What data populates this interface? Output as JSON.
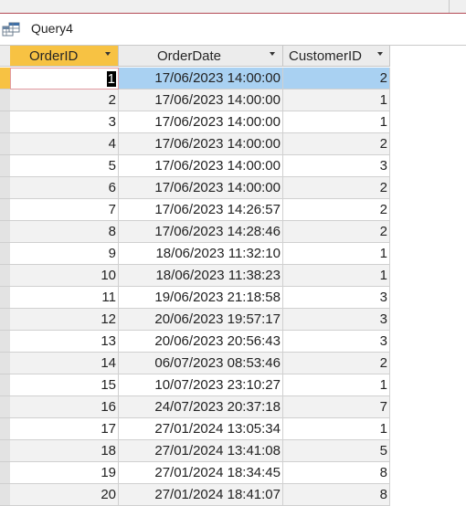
{
  "tab": {
    "title": "Query4",
    "icon": "query-datasheet-icon"
  },
  "columns": [
    {
      "label": "OrderID",
      "active": true
    },
    {
      "label": "OrderDate",
      "active": false
    },
    {
      "label": "CustomerID",
      "active": false
    }
  ],
  "rows": [
    {
      "order_id": "1",
      "order_date": "17/06/2023 14:00:00",
      "customer_id": "2"
    },
    {
      "order_id": "2",
      "order_date": "17/06/2023 14:00:00",
      "customer_id": "1"
    },
    {
      "order_id": "3",
      "order_date": "17/06/2023 14:00:00",
      "customer_id": "1"
    },
    {
      "order_id": "4",
      "order_date": "17/06/2023 14:00:00",
      "customer_id": "2"
    },
    {
      "order_id": "5",
      "order_date": "17/06/2023 14:00:00",
      "customer_id": "3"
    },
    {
      "order_id": "6",
      "order_date": "17/06/2023 14:00:00",
      "customer_id": "2"
    },
    {
      "order_id": "7",
      "order_date": "17/06/2023 14:26:57",
      "customer_id": "2"
    },
    {
      "order_id": "8",
      "order_date": "17/06/2023 14:28:46",
      "customer_id": "2"
    },
    {
      "order_id": "9",
      "order_date": "18/06/2023 11:32:10",
      "customer_id": "1"
    },
    {
      "order_id": "10",
      "order_date": "18/06/2023 11:38:23",
      "customer_id": "1"
    },
    {
      "order_id": "11",
      "order_date": "19/06/2023 21:18:58",
      "customer_id": "3"
    },
    {
      "order_id": "12",
      "order_date": "20/06/2023 19:57:17",
      "customer_id": "3"
    },
    {
      "order_id": "13",
      "order_date": "20/06/2023 20:56:43",
      "customer_id": "3"
    },
    {
      "order_id": "14",
      "order_date": "06/07/2023 08:53:46",
      "customer_id": "2"
    },
    {
      "order_id": "15",
      "order_date": "10/07/2023 23:10:27",
      "customer_id": "1"
    },
    {
      "order_id": "16",
      "order_date": "24/07/2023 20:37:18",
      "customer_id": "7"
    },
    {
      "order_id": "17",
      "order_date": "27/01/2024 13:05:34",
      "customer_id": "1"
    },
    {
      "order_id": "18",
      "order_date": "27/01/2024 13:41:08",
      "customer_id": "5"
    },
    {
      "order_id": "19",
      "order_date": "27/01/2024 18:34:45",
      "customer_id": "8"
    },
    {
      "order_id": "20",
      "order_date": "27/01/2024 18:41:07",
      "customer_id": "8"
    }
  ],
  "colors": {
    "header_active": "#f7c243",
    "selection": "#a9d1f2",
    "alt_row": "#f2f2f2"
  }
}
